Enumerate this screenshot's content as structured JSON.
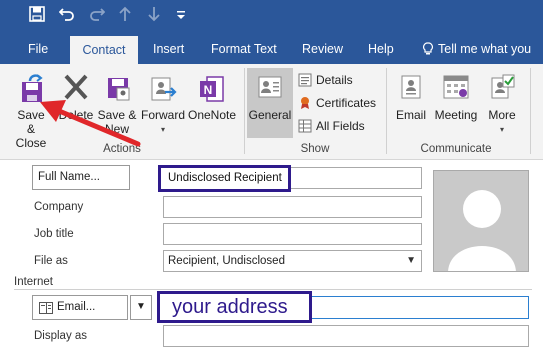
{
  "tabs": [
    "File",
    "Contact",
    "Insert",
    "Format Text",
    "Review",
    "Help",
    "Tell me what you"
  ],
  "ribbon": {
    "actions": {
      "save_close": "Save & Close",
      "delete": "Delete",
      "save_new": "Save & New",
      "forward": "Forward",
      "onenote": "OneNote",
      "group": "Actions"
    },
    "show": {
      "general": "General",
      "details": "Details",
      "certificates": "Certificates",
      "all_fields": "All Fields",
      "group": "Show"
    },
    "communicate": {
      "email": "Email",
      "meeting": "Meeting",
      "more": "More",
      "group": "Communicate"
    }
  },
  "form": {
    "full_name_button": "Full Name...",
    "full_name_value": "Undisclosed Recipient",
    "company_label": "Company",
    "job_title_label": "Job title",
    "file_as_label": "File as",
    "file_as_value": "Recipient, Undisclosed",
    "internet_label": "Internet",
    "email_button": "Email...",
    "email_value": "your address",
    "display_as_label": "Display as"
  },
  "colors": {
    "brand": "#2b579a",
    "callout": "#2e1a8c",
    "arrow": "#e0272a"
  }
}
